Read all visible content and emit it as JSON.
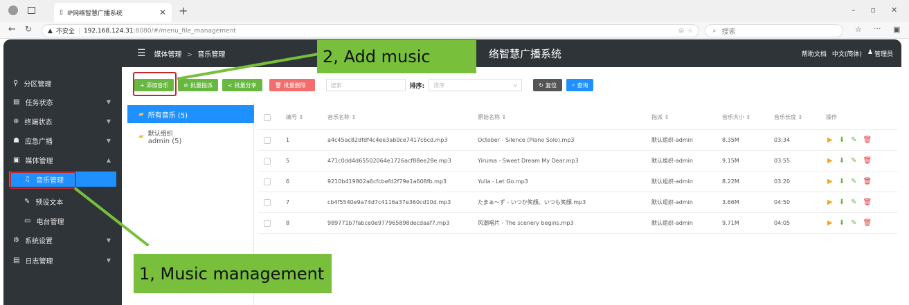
{
  "browser": {
    "tab_title": "IP网络智慧广播系统",
    "new_tab": "+",
    "not_secure": "不安全",
    "url_host": "192.168.124.31",
    "url_path": ":8080/#/menu_file_management",
    "search_placeholder": "搜索",
    "win_min": "–",
    "win_restore": "▫",
    "win_close": "✕"
  },
  "header": {
    "breadcrumb_parent": "媒体管理",
    "breadcrumb_sep": ">",
    "breadcrumb_current": "音乐管理",
    "system_name": "络智慧广播系统",
    "help": "帮助文档",
    "language": "中文(简体)",
    "user": "管理员"
  },
  "sidebar": {
    "items": [
      {
        "label": "分区管理",
        "icon": "link-icon"
      },
      {
        "label": "任务状态",
        "icon": "list-icon"
      },
      {
        "label": "终端状态",
        "icon": "terminal-icon"
      },
      {
        "label": "应急广播",
        "icon": "broadcast-icon"
      },
      {
        "label": "媒体管理",
        "icon": "media-icon"
      },
      {
        "label": "音乐管理",
        "icon": "music-icon"
      },
      {
        "label": "预设文本",
        "icon": "text-icon"
      },
      {
        "label": "电台管理",
        "icon": "radio-icon"
      },
      {
        "label": "系统设置",
        "icon": "settings-icon"
      },
      {
        "label": "日志管理",
        "icon": "log-icon"
      }
    ]
  },
  "toolbar": {
    "add": "+ 添加音乐",
    "batch_assign": "批量指派",
    "batch_share": "批量分享",
    "batch_delete": "批量删除",
    "search_placeholder": "搜索",
    "sort_label": "排序:",
    "sort_placeholder": "排序",
    "reset": "复位",
    "query": "查询"
  },
  "groups": {
    "all": "所有音乐 (5)",
    "default_line1": "默认组织",
    "default_line2": "admin (5)"
  },
  "table": {
    "headers": [
      "编号",
      "音乐名称",
      "原始名称",
      "指派",
      "音乐大小",
      "音乐长度",
      "操作"
    ],
    "rows": [
      [
        "1",
        "a4c45ac82dfdf4c4ee3ab0ce7417c6cd.mp3",
        "October - Silence (Piano Solo).mp3",
        "默认组织-admin",
        "8.35M",
        "03:34"
      ],
      [
        "5",
        "471c0dd4d65502064e1726acf88ee28e.mp3",
        "Yiruma - Sweet Dream My Dear.mp3",
        "默认组织-admin",
        "9.15M",
        "03:55"
      ],
      [
        "6",
        "9210b419802a6cfcbefd2f79e1a608fb.mp3",
        "Yulia - Let Go.mp3",
        "默认组织-admin",
        "8.22M",
        "03:20"
      ],
      [
        "7",
        "cb4f5540e9a74d7c4116a37e360cd10d.mp3",
        "たまぁ～ず - いつか笑顔、いつも笑顔.mp3",
        "默认组织-admin",
        "3.66M",
        "04:50"
      ],
      [
        "8",
        "989771b7fabce0e977965898decdaaf7.mp3",
        "风潮唱片 - The scenery begins.mp3",
        "默认组织-admin",
        "9.71M",
        "04:05"
      ]
    ]
  },
  "annotations": {
    "step1": "1, Music management",
    "step2": "2, Add music"
  },
  "colors": {
    "sidebar": "#2f3438",
    "accent": "#1e90ff",
    "green": "#67b741",
    "red": "#f56c6c",
    "callout": "#78c03c"
  }
}
